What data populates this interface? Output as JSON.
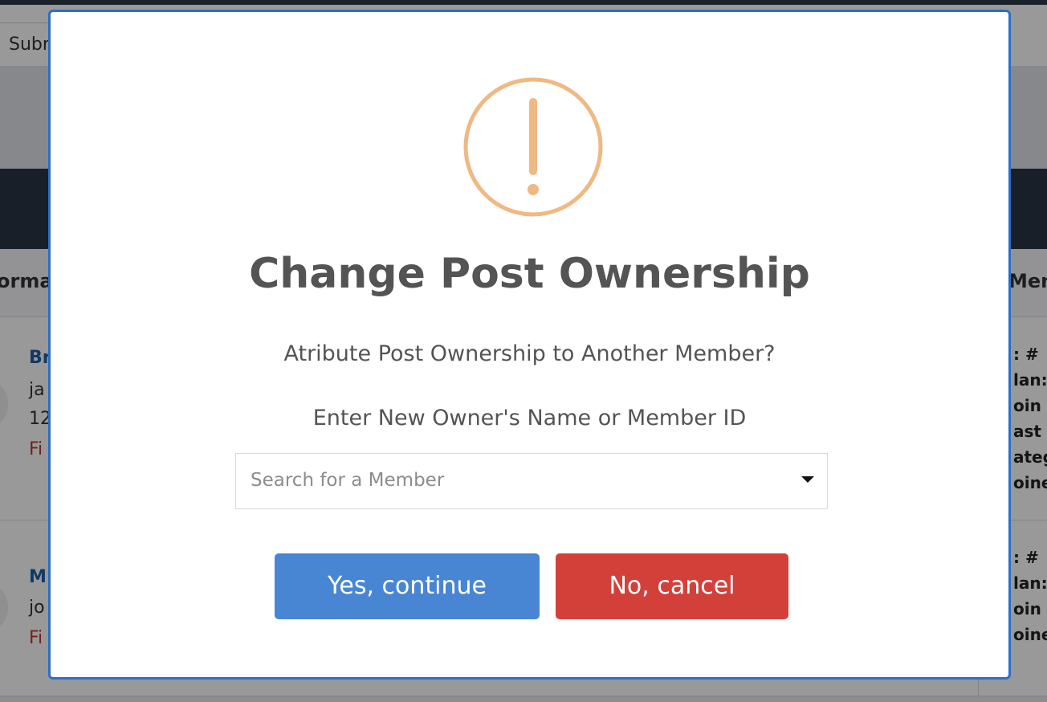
{
  "background": {
    "toolbar_button": "Subm",
    "header_left": "orma",
    "header_right": "Mem",
    "card1": {
      "name": "Br",
      "line1": "ja",
      "line2": "12",
      "status": "Fi",
      "right_lines": [
        ": #",
        "lan:",
        "oin",
        "ast",
        "ateg",
        "oine"
      ]
    },
    "card2": {
      "name": "M",
      "line1": "jo",
      "status": "Fi",
      "right_lines": [
        ": #",
        "lan:",
        "oin",
        "oine"
      ]
    }
  },
  "modal": {
    "icon": "exclamation-circle-icon",
    "icon_color": "#f0b882",
    "title": "Change Post Ownership",
    "question": "Atribute Post Ownership to Another Member?",
    "instruction": "Enter New Owner's Name or Member ID",
    "select": {
      "placeholder": "Search for a Member"
    },
    "confirm_label": "Yes, continue",
    "cancel_label": "No, cancel",
    "confirm_color": "#4886d4",
    "cancel_color": "#d3403a",
    "border_color": "#2e6ec4"
  }
}
